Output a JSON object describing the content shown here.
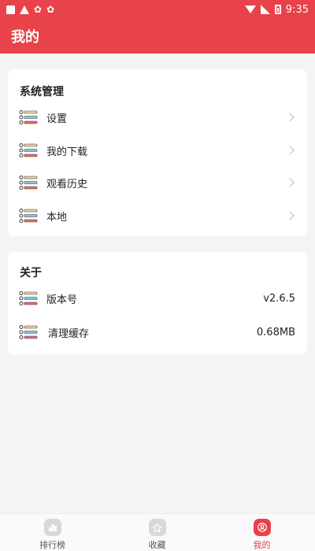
{
  "status_bar": {
    "time": "9:35"
  },
  "header": {
    "title": "我的"
  },
  "system_section": {
    "title": "系统管理",
    "items": [
      {
        "label": "设置",
        "icon": "list-icon"
      },
      {
        "label": "我的下载",
        "icon": "list-icon"
      },
      {
        "label": "观看历史",
        "icon": "list-icon"
      },
      {
        "label": "本地",
        "icon": "list-icon"
      }
    ]
  },
  "about_section": {
    "title": "关于",
    "items": [
      {
        "label": "版本号",
        "value": "v2.6.5",
        "icon": "list-icon"
      },
      {
        "label": "清理缓存",
        "value": "0.68MB",
        "icon": "list-icon"
      }
    ]
  },
  "tab_bar": {
    "tabs": [
      {
        "label": "排行榜",
        "icon": "ranking-icon",
        "active": false
      },
      {
        "label": "收藏",
        "icon": "star-icon",
        "active": false
      },
      {
        "label": "我的",
        "icon": "user-icon",
        "active": true
      }
    ]
  },
  "colors": {
    "accent": "#e8424a",
    "background": "#f4f4f4",
    "card": "#ffffff"
  }
}
